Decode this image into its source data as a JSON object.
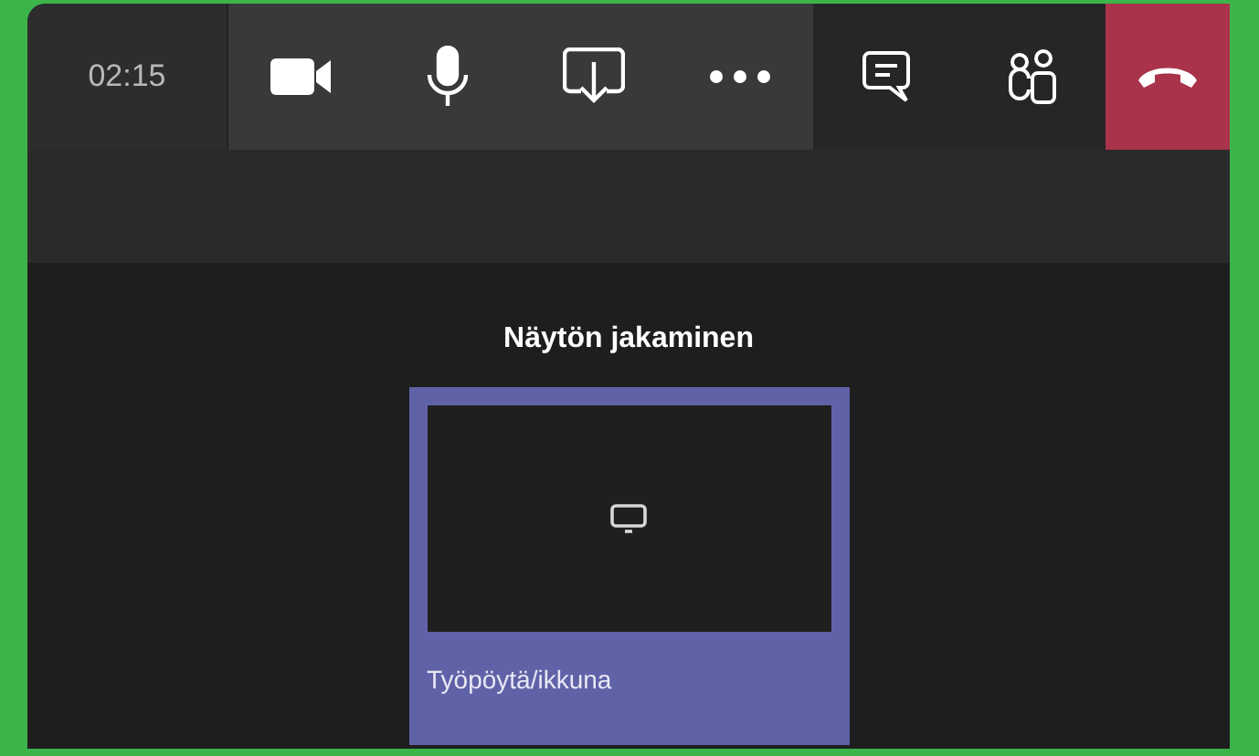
{
  "call_bar": {
    "timer": "02:15",
    "controls": [
      {
        "kind": "camera"
      },
      {
        "kind": "microphone"
      },
      {
        "kind": "share"
      },
      {
        "kind": "more"
      }
    ],
    "side_controls": [
      {
        "kind": "chat"
      },
      {
        "kind": "participants"
      }
    ],
    "hang_up": {
      "kind": "hangup"
    }
  },
  "share_panel": {
    "title": "Näytön jakaminen",
    "options": [
      {
        "label": "Työpöytä/ikkuna",
        "selected": true
      }
    ]
  }
}
